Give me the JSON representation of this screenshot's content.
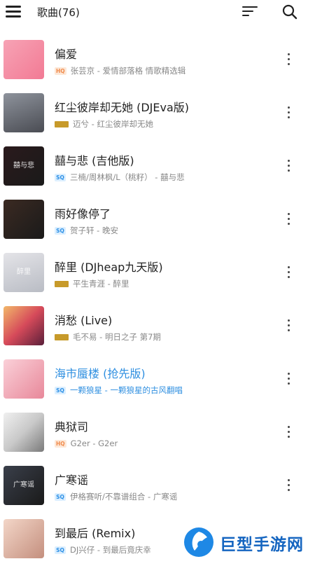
{
  "header": {
    "title": "歌曲(76)",
    "menu_icon": "hamburger-menu-icon",
    "sort_icon": "sort-icon",
    "search_icon": "search-icon"
  },
  "songs": [
    {
      "title": "偏爱",
      "quality": "HQ",
      "subtitle": "张芸京 - 爱情部落格 情歌精选辑",
      "active": false,
      "cover_color": "#f27a94",
      "cover_text": ""
    },
    {
      "title": "红尘彼岸却无她 (DJEva版)",
      "quality": "gold",
      "subtitle": "迈兮 - 红尘彼岸却无她",
      "active": false,
      "cover_color": "#6b6e78",
      "cover_text": ""
    },
    {
      "title": "囍与悲 (吉他版)",
      "quality": "SQ",
      "subtitle": "三楠/周林枫/L（桃籽） - 囍与悲",
      "active": false,
      "cover_color": "#2a1a1c",
      "cover_text": "囍与悲"
    },
    {
      "title": "雨好像停了",
      "quality": "SQ",
      "subtitle": "贺子轩 - 晚安",
      "active": false,
      "cover_color": "#3b2a22",
      "cover_text": ""
    },
    {
      "title": "醉里 (DJheap九天版)",
      "quality": "gold",
      "subtitle": "平生青涯 - 醉里",
      "active": false,
      "cover_color": "#b9bcc4",
      "cover_text": "醉里"
    },
    {
      "title": "消愁 (Live)",
      "quality": "gold",
      "subtitle": "毛不易 - 明日之子 第7期",
      "active": false,
      "cover_color": "#d64a5a",
      "cover_text": ""
    },
    {
      "title": "海市蜃楼 (抢先版)",
      "quality": "SQ",
      "subtitle": "一颗狼星 - 一颗狼星的古风翻唱",
      "active": true,
      "cover_color": "#e8889a",
      "cover_text": ""
    },
    {
      "title": "典狱司",
      "quality": "HQ",
      "subtitle": "G2er - G2er",
      "active": false,
      "cover_color": "#c9c9c9",
      "cover_text": ""
    },
    {
      "title": "广寒谣",
      "quality": "SQ",
      "subtitle": "伊格赛听/不靠谱组合 - 广寒谣",
      "active": false,
      "cover_color": "#3a3f4a",
      "cover_text": "广寒谣"
    },
    {
      "title": "到最后 (Remix)",
      "quality": "SQ",
      "subtitle": "DJ兴仔 - 到最后竟庆幸",
      "active": false,
      "cover_color": "#c48f7e",
      "cover_text": ""
    }
  ],
  "more_icon": "more-vertical-icon",
  "watermark": {
    "text": "巨型手游网"
  },
  "colors": {
    "accent": "#2f8fe0",
    "hq": "#f08a4b",
    "sq": "#2b8fe6",
    "gold": "#c79a2a"
  }
}
